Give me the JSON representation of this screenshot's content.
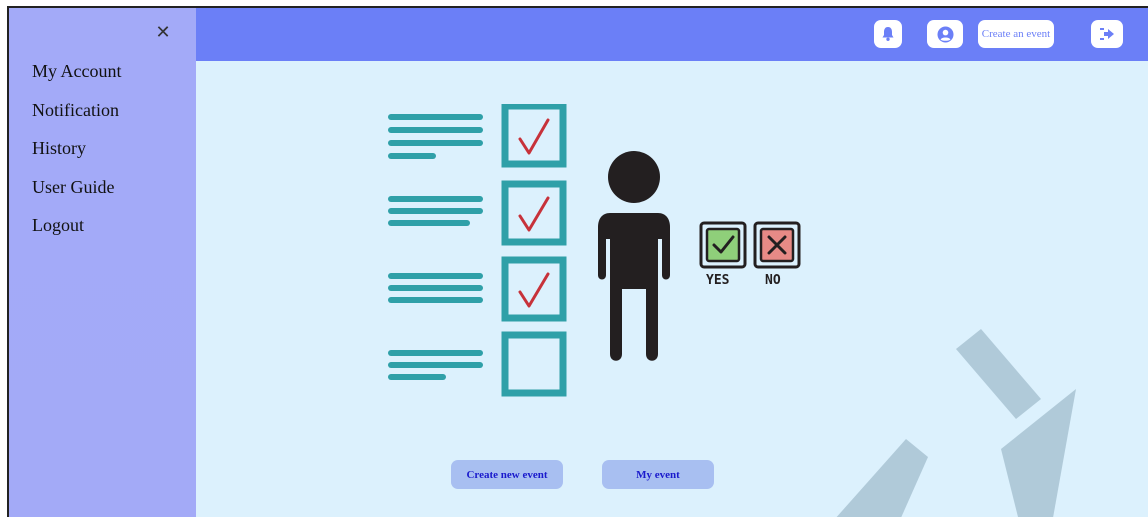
{
  "sidebar": {
    "close_glyph": "✕",
    "items": [
      {
        "label": "My Account"
      },
      {
        "label": "Notification"
      },
      {
        "label": "History"
      },
      {
        "label": "User Guide"
      },
      {
        "label": "Logout"
      }
    ]
  },
  "topbar": {
    "create_event_label": "Create an event",
    "icons": [
      "bell-icon",
      "user-circle-icon",
      "logout-icon"
    ]
  },
  "illustration": {
    "yes_label": "YES",
    "no_label": "NO"
  },
  "actions": {
    "create_new_event_label": "Create new event",
    "my_event_label": "My event"
  },
  "colors": {
    "sidebar": "#a3aaf8",
    "topbar": "#6b7ff7",
    "main_bg": "#dcf1fd",
    "teal": "#2fa0a8",
    "check": "#c7323a",
    "button_bg": "#a8bff1",
    "button_text": "#1a1acc"
  }
}
